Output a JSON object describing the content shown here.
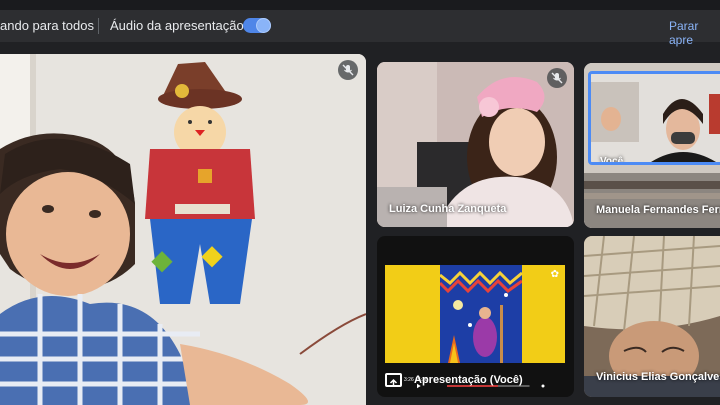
{
  "banner": {
    "presenting_text": "ando para todos",
    "audio_label": "Áudio da apresentação",
    "audio_enabled": true,
    "stop_link": "Parar apre"
  },
  "tiles": {
    "luiza": {
      "name": "Luiza Cunha Zanqueta",
      "muted": true
    },
    "manuela": {
      "name": "Manuela Fernandes Ferr",
      "self_label": "Você"
    },
    "presentation": {
      "name": "Apresentação (Você)",
      "video_time": "3:26 / 5:30"
    },
    "vinicius": {
      "name": "Vinicius Elias Gonçalves"
    },
    "main": {
      "muted": true
    }
  },
  "colors": {
    "accent": "#8ab4f8",
    "toggle": "#4f86e8",
    "background": "#202124"
  },
  "icons": [
    "mic-off-icon",
    "present-screen-icon",
    "toggle-switch"
  ]
}
